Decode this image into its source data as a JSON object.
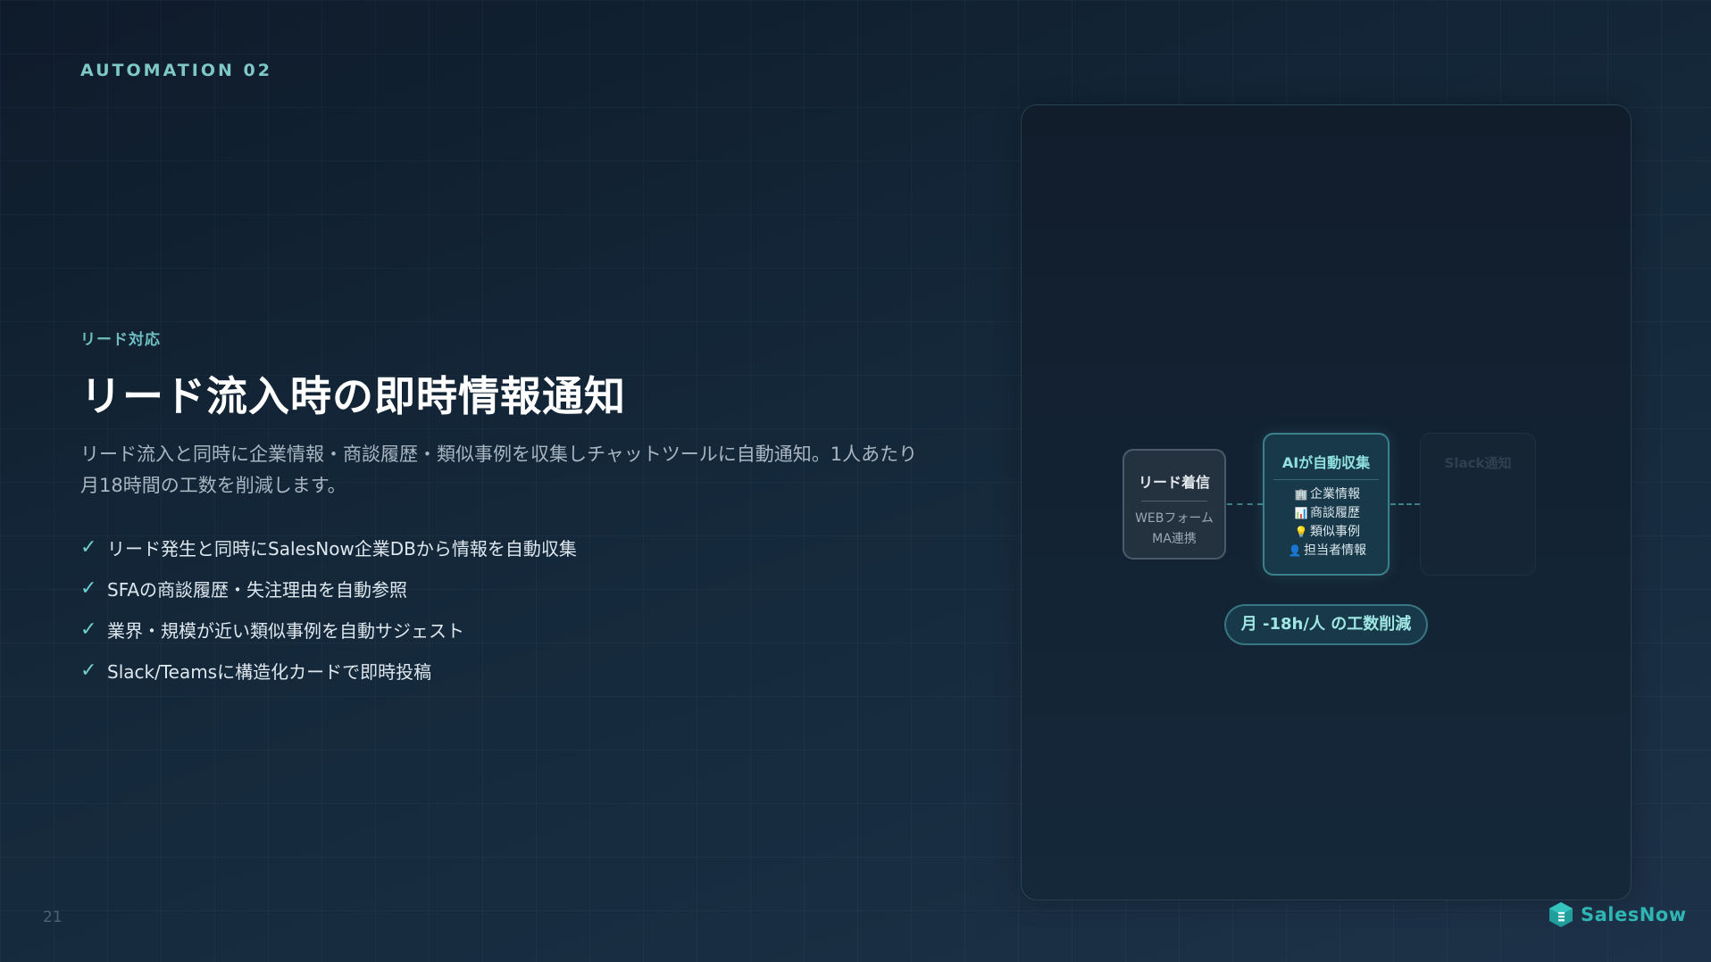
{
  "header": {
    "section_label": "AUTOMATION 02"
  },
  "main": {
    "category": "リード対応",
    "title": "リード流入時の即時情報通知",
    "description_line1": "リード流入と同時に企業情報・商談履歴・類似事例を収集しチャットツールに自動通知。1人あたり",
    "description_line2": "月18時間の工数を削減します。",
    "bullets": [
      "リード発生と同時にSalesNow企業DBから情報を自動収集",
      "SFAの商談履歴・失注理由を自動参照",
      "業界・規模が近い類似事例を自動サジェスト",
      "Slack/Teamsに構造化カードで即時投稿"
    ],
    "check_glyph": "✓"
  },
  "diagram": {
    "lead_node": {
      "title": "リード着信",
      "lines": [
        "WEBフォーム",
        "MA連携"
      ]
    },
    "ai_node": {
      "title": "AIが自動収集",
      "items": [
        {
          "icon": "building-icon",
          "glyph": "🏢",
          "label": "企業情報"
        },
        {
          "icon": "chart-icon",
          "glyph": "📊",
          "label": "商談履歴"
        },
        {
          "icon": "lightbulb-icon",
          "glyph": "💡",
          "label": "類似事例"
        },
        {
          "icon": "person-icon",
          "glyph": "👤",
          "label": "担当者情報"
        }
      ]
    },
    "slack_node": {
      "title": "Slack通知"
    },
    "metric": "月 -18h/人 の工数削減"
  },
  "footer": {
    "page_number": "21",
    "brand_name": "SalesNow"
  },
  "colors": {
    "accent": "#6fd0cf",
    "brand": "#2fb6b4",
    "background": "#14283a"
  }
}
